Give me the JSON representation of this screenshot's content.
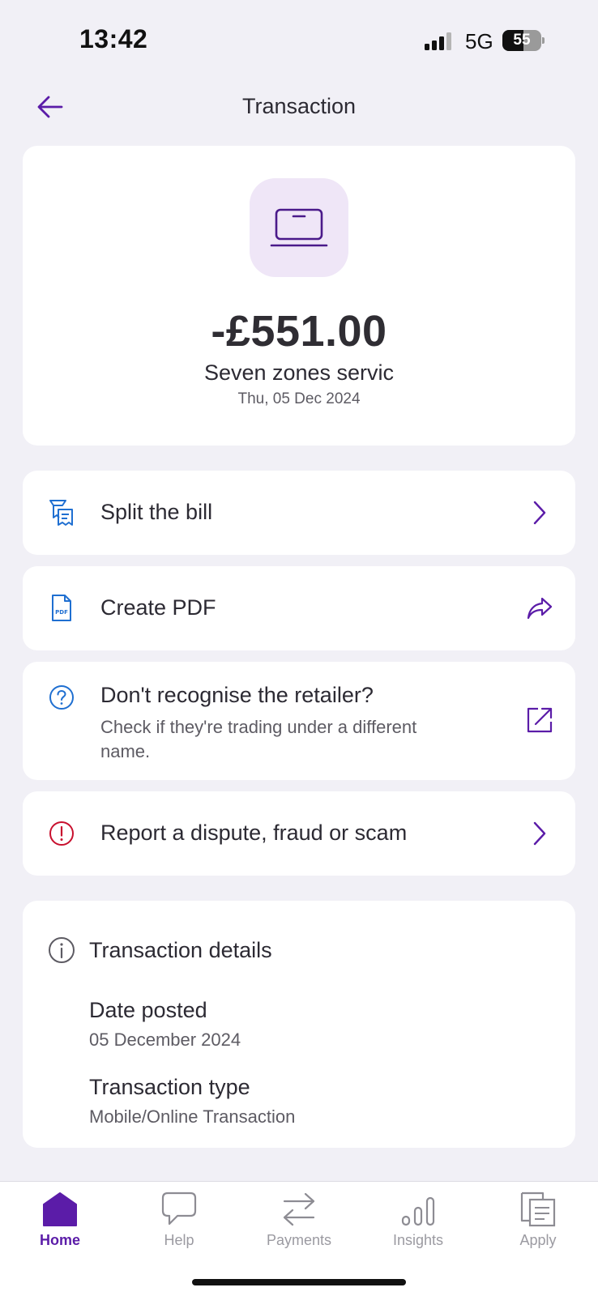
{
  "status_bar": {
    "time": "13:42",
    "network": "5G",
    "battery_level": "55",
    "battery_percent": 0.55
  },
  "header": {
    "title": "Transaction",
    "back_icon": "arrow-left-icon"
  },
  "transaction": {
    "icon": "laptop-icon",
    "amount": "-£551.00",
    "merchant": "Seven zones servic",
    "date": "Thu, 05 Dec 2024"
  },
  "actions": {
    "split": {
      "label": "Split the bill",
      "icon": "receipt-split-icon",
      "trail_icon": "chevron-right-icon"
    },
    "pdf": {
      "label": "Create PDF",
      "icon": "pdf-file-icon",
      "trail_icon": "share-arrow-icon"
    },
    "retailer": {
      "label": "Don't recognise the retailer?",
      "sub": "Check if they're trading under a different name.",
      "icon": "question-circle-icon",
      "trail_icon": "external-link-icon"
    },
    "dispute": {
      "label": "Report a dispute, fraud or scam",
      "icon": "exclamation-circle-icon",
      "trail_icon": "chevron-right-icon"
    }
  },
  "details": {
    "title": "Transaction details",
    "icon": "info-circle-icon",
    "rows": [
      {
        "label": "Date posted",
        "value": "05 December 2024"
      },
      {
        "label": "Transaction type",
        "value": "Mobile/Online Transaction"
      }
    ]
  },
  "tabbar": {
    "items": [
      {
        "label": "Home",
        "icon": "home-icon",
        "active": true
      },
      {
        "label": "Help",
        "icon": "speech-bubble-icon",
        "active": false
      },
      {
        "label": "Payments",
        "icon": "transfer-arrows-icon",
        "active": false
      },
      {
        "label": "Insights",
        "icon": "insights-bars-icon",
        "active": false
      },
      {
        "label": "Apply",
        "icon": "documents-icon",
        "active": false
      }
    ]
  },
  "colors": {
    "accent": "#5b1ca8",
    "info_blue": "#1f6fd1",
    "alert_red": "#c8102e",
    "background": "#f1f0f6"
  }
}
